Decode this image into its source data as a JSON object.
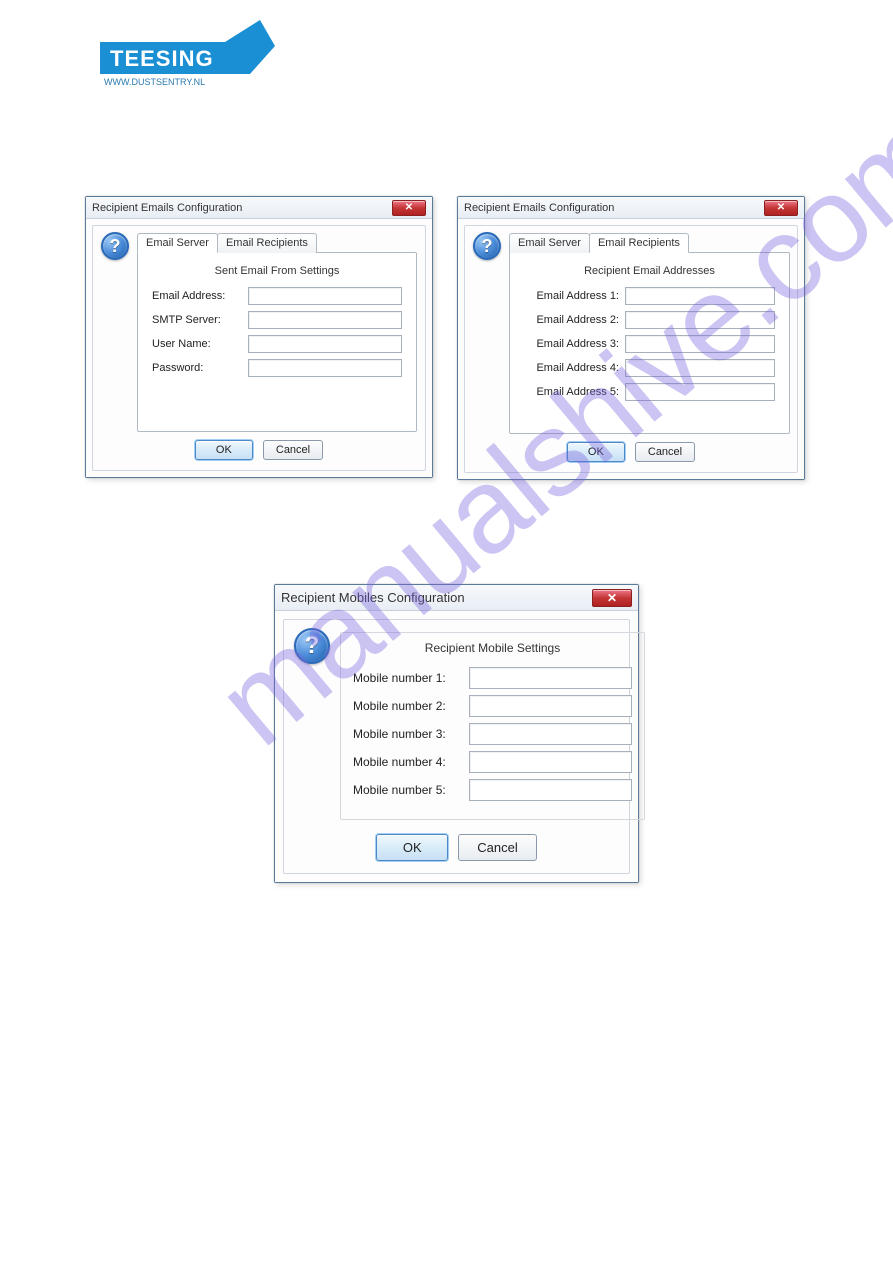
{
  "logo": {
    "brand": "TEESING",
    "url": "WWW.DUSTSENTRY.NL"
  },
  "watermark": "manualshive.com",
  "dialog1": {
    "title": "Recipient Emails Configuration",
    "tabs": {
      "server": "Email Server",
      "recipients": "Email Recipients"
    },
    "section": "Sent Email From Settings",
    "fields": {
      "email": {
        "label": "Email Address:",
        "value": ""
      },
      "smtp": {
        "label": "SMTP Server:",
        "value": ""
      },
      "user": {
        "label": "User Name:",
        "value": ""
      },
      "pass": {
        "label": "Password:",
        "value": ""
      }
    },
    "ok": "OK",
    "cancel": "Cancel"
  },
  "dialog2": {
    "title": "Recipient Emails Configuration",
    "tabs": {
      "server": "Email Server",
      "recipients": "Email Recipients"
    },
    "section": "Recipient Email Addresses",
    "fields": {
      "e1": {
        "label": "Email Address 1:",
        "value": ""
      },
      "e2": {
        "label": "Email Address 2:",
        "value": ""
      },
      "e3": {
        "label": "Email Address 3:",
        "value": ""
      },
      "e4": {
        "label": "Email Address 4:",
        "value": ""
      },
      "e5": {
        "label": "Email Address 5:",
        "value": ""
      }
    },
    "ok": "OK",
    "cancel": "Cancel"
  },
  "dialog3": {
    "title": "Recipient Mobiles Configuration",
    "section": "Recipient Mobile Settings",
    "fields": {
      "m1": {
        "label": "Mobile number 1:",
        "value": ""
      },
      "m2": {
        "label": "Mobile number 2:",
        "value": ""
      },
      "m3": {
        "label": "Mobile number 3:",
        "value": ""
      },
      "m4": {
        "label": "Mobile number 4:",
        "value": ""
      },
      "m5": {
        "label": "Mobile number 5:",
        "value": ""
      }
    },
    "ok": "OK",
    "cancel": "Cancel"
  }
}
